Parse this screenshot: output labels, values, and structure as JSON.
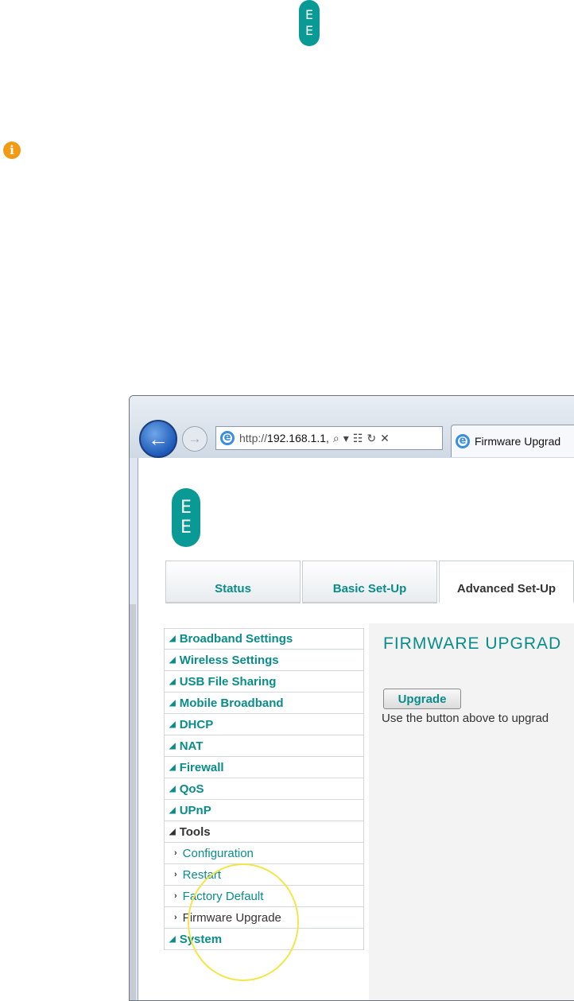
{
  "top_logo": {
    "letters": [
      "E",
      "E"
    ]
  },
  "info_icon": {
    "symbol": "i",
    "color": "#f39a14"
  },
  "browser": {
    "url_prefix": "http://",
    "url_host": "192.168.1.1",
    "tab_title": "Firmware Upgrad"
  },
  "page": {
    "logo_letters": [
      "E",
      "E"
    ],
    "nav_tabs": [
      {
        "label": "Status",
        "active": false
      },
      {
        "label": "Basic Set-Up",
        "active": false
      },
      {
        "label": "Advanced Set-Up",
        "active": true
      }
    ],
    "sidebar": {
      "items": [
        {
          "label": "Broadband Settings"
        },
        {
          "label": "Wireless Settings"
        },
        {
          "label": "USB File Sharing"
        },
        {
          "label": "Mobile Broadband"
        },
        {
          "label": "DHCP"
        },
        {
          "label": "NAT"
        },
        {
          "label": "Firewall"
        },
        {
          "label": "QoS"
        },
        {
          "label": "UPnP"
        },
        {
          "label": "Tools"
        },
        {
          "label": "Configuration"
        },
        {
          "label": "Restart"
        },
        {
          "label": "Factory Default"
        },
        {
          "label": "Firmware Upgrade"
        },
        {
          "label": "System"
        }
      ]
    },
    "main": {
      "title": "FIRMWARE UPGRAD",
      "button_label": "Upgrade",
      "description": "Use the button above to upgrad"
    }
  },
  "colors": {
    "brand": "#0a8c8a",
    "highlight": "#f2e64a"
  }
}
